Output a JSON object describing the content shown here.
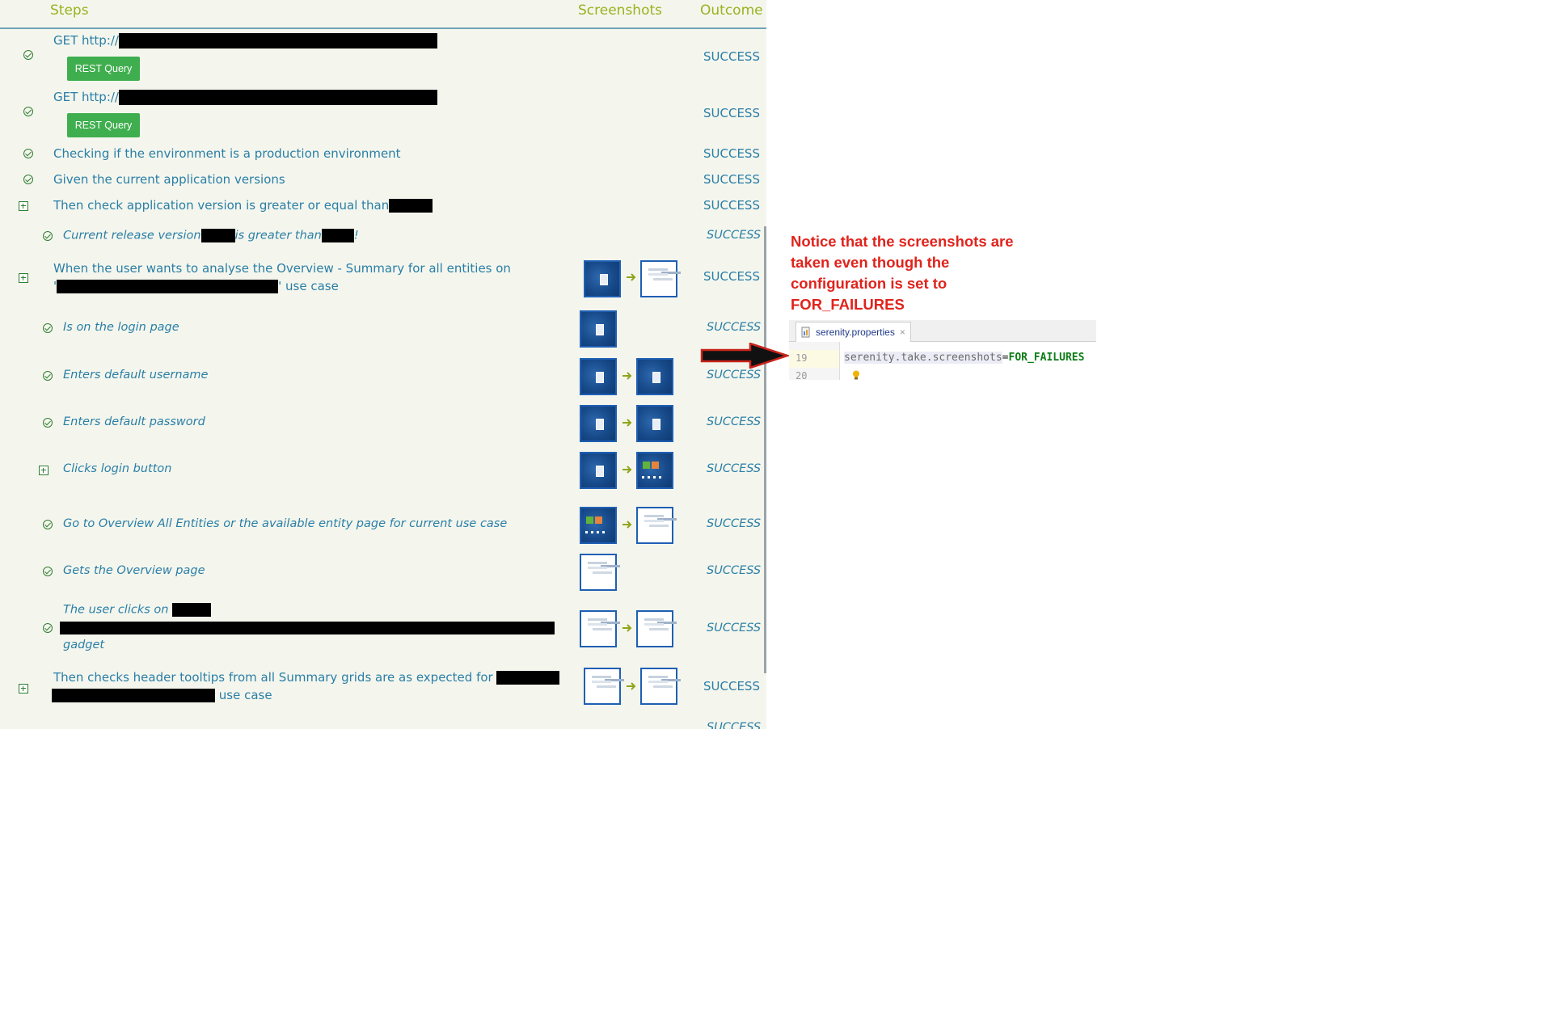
{
  "header": {
    "steps": "Steps",
    "screenshots": "Screenshots",
    "outcome": "Outcome"
  },
  "steps": [
    {
      "text": "GET http://",
      "button": "REST Query",
      "outcome": "SUCCESS"
    },
    {
      "text": "GET http://",
      "button": "REST Query",
      "outcome": "SUCCESS"
    },
    {
      "text": "Checking if the environment is a production environment",
      "outcome": "SUCCESS"
    },
    {
      "text": "Given the current application versions",
      "outcome": "SUCCESS"
    },
    {
      "text": "Then check application version is greater or equal than",
      "outcome": "SUCCESS"
    },
    {
      "text_a": "Current release version",
      "text_b": "is greater than",
      "text_c": "!",
      "outcome": "SUCCESS"
    },
    {
      "line1": "When the user wants to analyse the Overview - Summary for all entities on",
      "line2_prefix": "'",
      "line2_suffix": "' use case",
      "outcome": "SUCCESS"
    },
    {
      "text": "Is on the login page",
      "outcome": "SUCCESS"
    },
    {
      "text": "Enters default username",
      "outcome": "SUCCESS"
    },
    {
      "text": "Enters default password",
      "outcome": "SUCCESS"
    },
    {
      "text": "Clicks login button",
      "outcome": "SUCCESS"
    },
    {
      "text": "Go to Overview All Entities or the available entity page for current use case",
      "outcome": "SUCCESS"
    },
    {
      "text": "Gets the Overview page",
      "outcome": "SUCCESS"
    },
    {
      "line1": "The user clicks on",
      "line3": "gadget",
      "outcome": "SUCCESS"
    },
    {
      "line1": "Then checks header tooltips from all Summary grids are as expected for",
      "line2_suffix": "use case",
      "outcome": "SUCCESS"
    },
    {
      "outcome_partial": "SUCCESS"
    }
  ],
  "annotation": {
    "note": "Notice that the screenshots are taken even though the configuration is set to FOR_FAILURES"
  },
  "ide": {
    "tab_label": "serenity.properties",
    "tab_close": "×",
    "line_19": "19",
    "line_20": "20",
    "code_key": "serenity.take.screenshots",
    "code_eq": "=",
    "code_value": "FOR_FAILURES"
  },
  "colors": {
    "step_text": "#2a7ea7",
    "header_text": "#99b21f",
    "success_icon": "#2f7d32",
    "button_bg": "#3fae4e",
    "note_red": "#e0231c",
    "panel_bg": "#f4f6ed"
  }
}
